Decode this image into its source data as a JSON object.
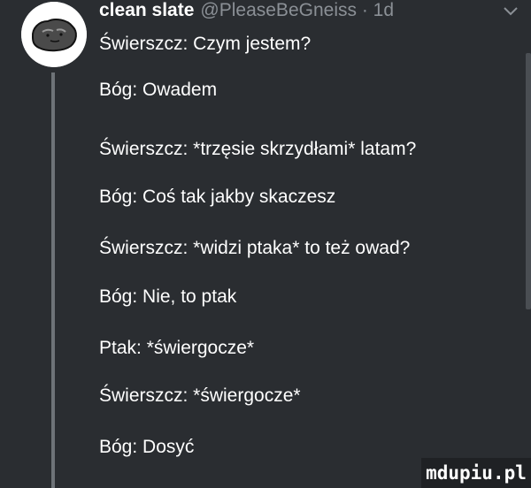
{
  "header": {
    "display_name": "clean slate",
    "handle_and_time": "@PleaseBeGneiss · 1d"
  },
  "tweet": {
    "lines": [
      "Świerszcz: Czym jestem?",
      "Bóg: Owadem",
      "Świerszcz: *trzęsie skrzydłami* latam?",
      "Bóg: Coś tak jakby skaczesz",
      "Świerszcz: *widzi ptaka* to też owad?",
      "Bóg: Nie, to ptak",
      "Ptak: *świergocze*",
      "Świerszcz: *świergocze*",
      "Bóg: Dosyć"
    ]
  },
  "watermark": {
    "text": "mdupiu.pl"
  },
  "icons": {
    "avatar": "rock-avatar-icon",
    "menu": "chevron-down-icon"
  },
  "colors": {
    "background": "#2a2d31",
    "text": "#ffffff",
    "secondary_text": "#8b9096",
    "thread_line": "#6e7378"
  }
}
